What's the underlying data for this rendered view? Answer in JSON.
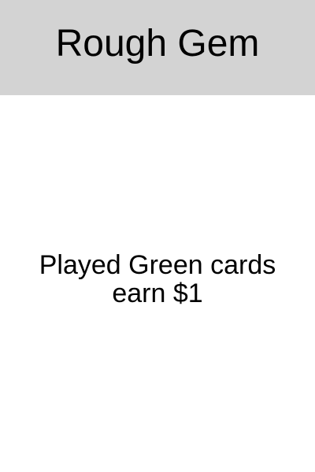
{
  "card": {
    "title": "Rough Gem",
    "description_lines": [
      "Played Green cards",
      "earn $1"
    ],
    "header_color": "#d3d3d3",
    "background_color": "#ffffff",
    "text_color": "#000000"
  }
}
